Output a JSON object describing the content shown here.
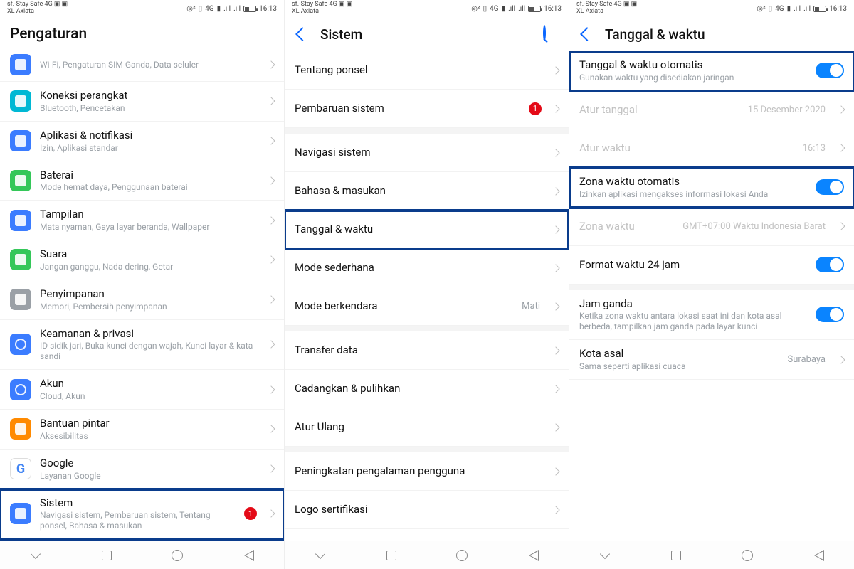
{
  "status": {
    "carrier_line1": "sf.-Stay Safe 4G",
    "carrier_line2": "XL Axiata",
    "time": "16:13",
    "net": "4G"
  },
  "screen1": {
    "title": "Pengaturan",
    "row0_sub": "Wi-Fi, Pengaturan SIM Ganda, Data seluler",
    "rows": [
      {
        "t": "Koneksi perangkat",
        "s": "Bluetooth, Pencetakan"
      },
      {
        "t": "Aplikasi & notifikasi",
        "s": "Izin, Aplikasi standar"
      },
      {
        "t": "Baterai",
        "s": "Mode hemat daya, Penggunaan baterai"
      },
      {
        "t": "Tampilan",
        "s": "Mata nyaman, Gaya layar beranda, Wallpaper"
      },
      {
        "t": "Suara",
        "s": "Jangan ganggu, Nada dering, Getar"
      },
      {
        "t": "Penyimpanan",
        "s": "Memori, Pembersih penyimpanan"
      },
      {
        "t": "Keamanan & privasi",
        "s": "ID sidik jari, Buka kunci dengan wajah, Kunci layar & kata sandi"
      },
      {
        "t": "Akun",
        "s": "Cloud, Akun"
      },
      {
        "t": "Bantuan pintar",
        "s": "Aksesibilitas"
      },
      {
        "t": "Google",
        "s": "Layanan Google"
      },
      {
        "t": "Sistem",
        "s": "Navigasi sistem, Pembaruan sistem, Tentang ponsel, Bahasa & masukan"
      }
    ],
    "badge_sistem": "1"
  },
  "screen2": {
    "title": "Sistem",
    "rows": [
      {
        "t": "Tentang ponsel"
      },
      {
        "t": "Pembaruan sistem",
        "badge": "1"
      },
      {
        "t": "Navigasi sistem"
      },
      {
        "t": "Bahasa & masukan"
      },
      {
        "t": "Tanggal & waktu",
        "hl": true
      },
      {
        "t": "Mode sederhana"
      },
      {
        "t": "Mode berkendara",
        "r": "Mati"
      },
      {
        "t": "Transfer data"
      },
      {
        "t": "Cadangkan & pulihkan"
      },
      {
        "t": "Atur Ulang"
      },
      {
        "t": "Peningkatan pengalaman pengguna"
      },
      {
        "t": "Logo sertifikasi"
      }
    ]
  },
  "screen3": {
    "title": "Tanggal & waktu",
    "auto_dt": {
      "t": "Tanggal & waktu otomatis",
      "s": "Gunakan waktu yang disediakan jaringan"
    },
    "set_date": {
      "t": "Atur tanggal",
      "r": "15 Desember 2020"
    },
    "set_time": {
      "t": "Atur waktu",
      "r": "16:13"
    },
    "auto_tz": {
      "t": "Zona waktu otomatis",
      "s": "Izinkan aplikasi mengakses informasi lokasi Anda"
    },
    "tz": {
      "t": "Zona waktu",
      "r": "GMT+07:00 Waktu Indonesia Barat"
    },
    "fmt24": {
      "t": "Format waktu 24 jam"
    },
    "dual": {
      "t": "Jam ganda",
      "s": "Ketika zona waktu antara lokasi saat ini dan kota asal berbeda, tampilkan jam ganda pada layar kunci"
    },
    "home": {
      "t": "Kota asal",
      "s": "Sama seperti aplikasi cuaca",
      "r": "Surabaya"
    }
  }
}
